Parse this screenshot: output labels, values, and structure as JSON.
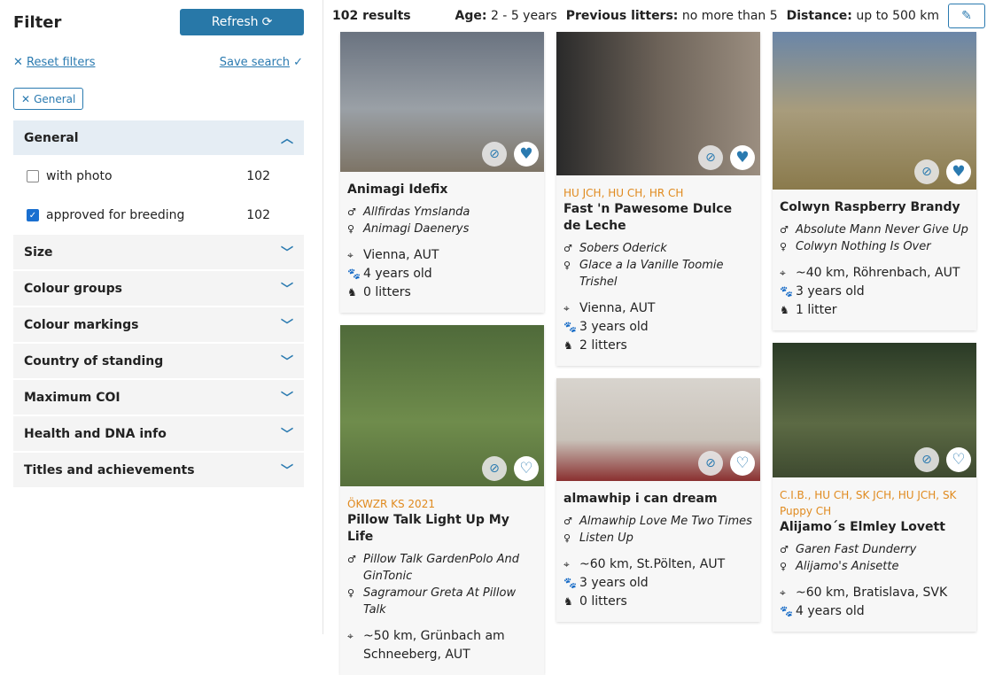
{
  "sidebar": {
    "title": "Filter",
    "refresh_label": "Refresh",
    "reset_label": "Reset filters",
    "save_label": "Save search",
    "chip_label": "General",
    "groups": [
      {
        "label": "General",
        "open": true,
        "options": [
          {
            "label": "with photo",
            "count": "102",
            "checked": false
          },
          {
            "label": "approved for breeding",
            "count": "102",
            "checked": true
          }
        ]
      },
      {
        "label": "Size"
      },
      {
        "label": "Colour groups"
      },
      {
        "label": "Colour markings"
      },
      {
        "label": "Country of standing"
      },
      {
        "label": "Maximum COI"
      },
      {
        "label": "Health and DNA info"
      },
      {
        "label": "Titles and achievements"
      }
    ]
  },
  "results": {
    "count": "102 results",
    "criteria": [
      {
        "key": "Age:",
        "value": "2 - 5 years"
      },
      {
        "key": "Previous litters:",
        "value": "no more than 5"
      },
      {
        "key": "Distance:",
        "value": "up to 500 km"
      }
    ]
  },
  "colors": {
    "accent": "#2878a8",
    "title": "#e08a1e"
  },
  "columns": [
    [
      {
        "titles": "",
        "name": "Animagi Idefix",
        "sire": "Allfirdas Ymslanda",
        "dam": "Animagi Daenerys",
        "location": "Vienna, AUT",
        "age": "4 years old",
        "litters": "0 litters",
        "favorite": true
      },
      {
        "titles": "ÖKWZR KS 2021",
        "name": "Pillow Talk Light Up My Life",
        "sire": "Pillow Talk GardenPolo And GinTonic",
        "dam": "Sagramour Greta At Pillow Talk",
        "location": "~50 km, Grünbach am Schneeberg, AUT",
        "age": "",
        "litters": "",
        "favorite": false
      }
    ],
    [
      {
        "titles": "HU JCH, HU CH, HR CH",
        "name": "Fast 'n Pawesome Dulce de Leche",
        "sire": "Sobers Oderick",
        "dam": "Glace a la Vanille Toomie Trishel",
        "location": "Vienna, AUT",
        "age": "3 years old",
        "litters": "2 litters",
        "favorite": true
      },
      {
        "titles": "",
        "name": "almawhip i can dream",
        "sire": "Almawhip Love Me Two Times",
        "dam": "Listen Up",
        "location": "~60 km, St.Pölten, AUT",
        "age": "3 years old",
        "litters": "0 litters",
        "favorite": false
      }
    ],
    [
      {
        "titles": "",
        "name": "Colwyn Raspberry Brandy",
        "sire": "Absolute Mann Never Give Up",
        "dam": "Colwyn Nothing Is Over",
        "location": "~40 km, Röhrenbach, AUT",
        "age": "3 years old",
        "litters": "1 litter",
        "favorite": true
      },
      {
        "titles": "C.I.B., HU CH, SK JCH, HU JCH, SK Puppy CH",
        "name": "Alijamo´s Elmley Lovett",
        "sire": "Garen Fast Dunderry",
        "dam": "Alijamo's Anisette",
        "location": "~60 km, Bratislava, SVK",
        "age": "4 years old",
        "litters": "",
        "favorite": false
      }
    ]
  ]
}
